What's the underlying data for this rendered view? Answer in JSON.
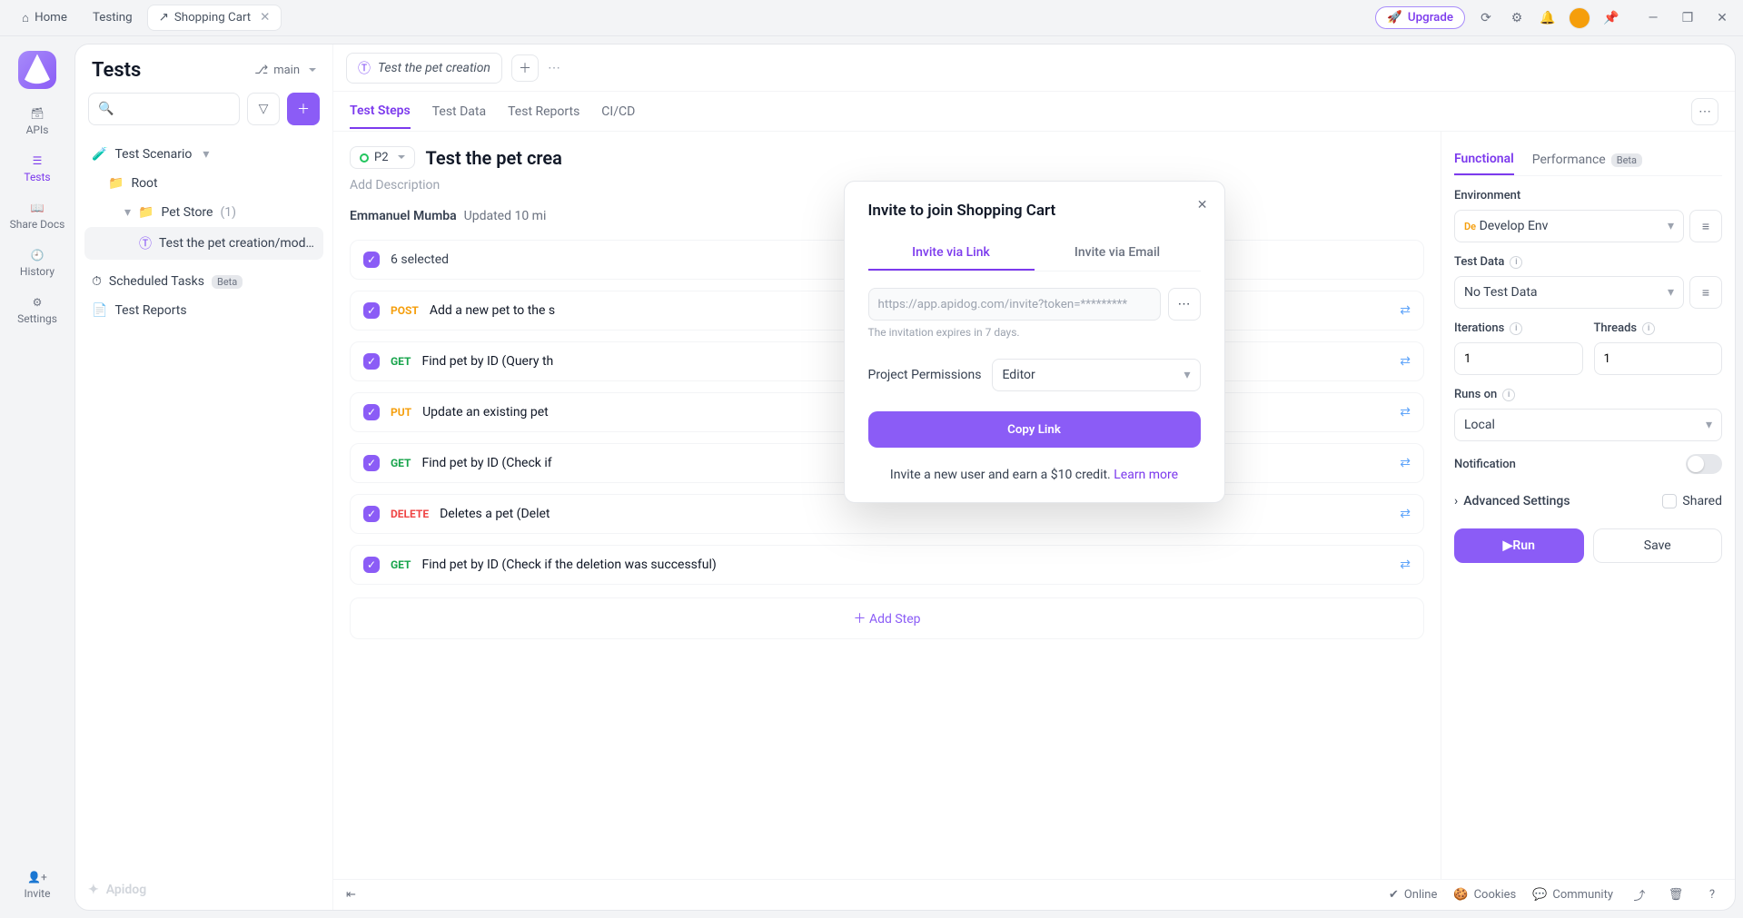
{
  "titlebar": {
    "home": "Home",
    "testing": "Testing",
    "active_tab": "Shopping Cart",
    "upgrade": "Upgrade"
  },
  "rail": {
    "apis": "APIs",
    "tests": "Tests",
    "share_docs": "Share Docs",
    "history": "History",
    "settings": "Settings",
    "invite": "Invite"
  },
  "left_panel": {
    "title": "Tests",
    "branch": "main",
    "sections": {
      "scenario": "Test Scenario",
      "root": "Root",
      "pet_store": "Pet Store",
      "pet_store_count": "(1)",
      "scenario_item": "Test the pet creation/modific",
      "scheduled": "Scheduled Tasks",
      "scheduled_badge": "Beta",
      "reports": "Test Reports"
    },
    "brand": "Apidog"
  },
  "main": {
    "file_tab": "Test the pet creation",
    "subtabs": {
      "steps": "Test Steps",
      "data": "Test Data",
      "reports": "Test Reports",
      "cicd": "CI/CD"
    },
    "priority": "P2",
    "title": "Test the pet crea",
    "description_ph": "Add Description",
    "author": "Emmanuel Mumba",
    "updated": "Updated 10 mi",
    "selected": "6 selected",
    "steps": [
      {
        "method": "POST",
        "cls": "m-post",
        "label": "Add a new pet to the s"
      },
      {
        "method": "GET",
        "cls": "m-get",
        "label": "Find pet by ID (Query th"
      },
      {
        "method": "PUT",
        "cls": "m-put",
        "label": "Update an existing pet"
      },
      {
        "method": "GET",
        "cls": "m-get",
        "label": "Find pet by ID (Check if"
      },
      {
        "method": "DELETE",
        "cls": "m-delete",
        "label": "Deletes a pet (Delet"
      },
      {
        "method": "GET",
        "cls": "m-get",
        "label": "Find pet by ID (Check if the deletion was successful)"
      }
    ],
    "add_step": "Add Step"
  },
  "config": {
    "tabs": {
      "functional": "Functional",
      "performance": "Performance",
      "beta": "Beta"
    },
    "env_label": "Environment",
    "env_prefix": "De",
    "env_value": "Develop Env",
    "test_data_label": "Test Data",
    "test_data_value": "No Test Data",
    "iterations_label": "Iterations",
    "iterations_value": "1",
    "threads_label": "Threads",
    "threads_value": "1",
    "runs_on_label": "Runs on",
    "runs_on_value": "Local",
    "notification_label": "Notification",
    "advanced": "Advanced Settings",
    "shared": "Shared",
    "run": "Run",
    "save": "Save"
  },
  "modal": {
    "title": "Invite to join Shopping Cart",
    "tab_link": "Invite via Link",
    "tab_email": "Invite via Email",
    "url_ph": "https://app.apidog.com/invite?token=*********",
    "expire": "The invitation expires in 7 days.",
    "perm_label": "Project Permissions",
    "perm_value": "Editor",
    "copy": "Copy Link",
    "earn_text": "Invite a new user and earn a $10 credit. ",
    "earn_link": "Learn more"
  },
  "statusbar": {
    "online": "Online",
    "cookies": "Cookies",
    "community": "Community"
  }
}
